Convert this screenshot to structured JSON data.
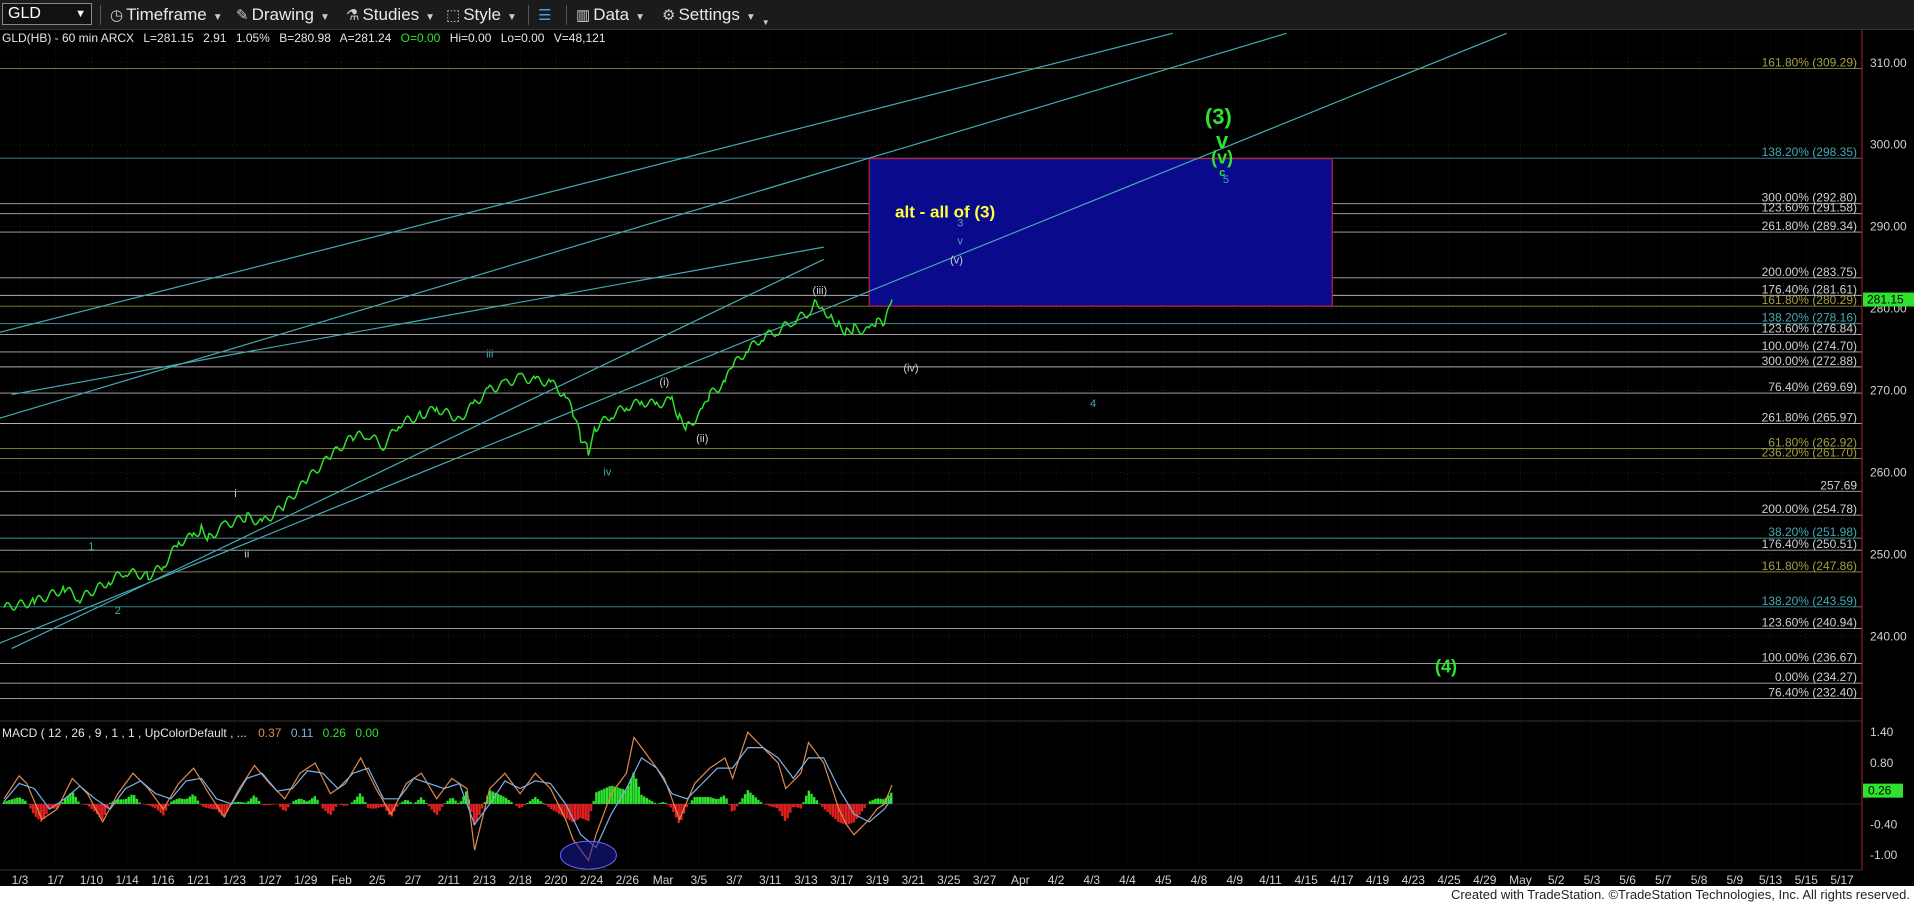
{
  "toolbar": {
    "symbol": "GLD",
    "timeframe_label": "Timeframe",
    "drawing_label": "Drawing",
    "studies_label": "Studies",
    "style_label": "Style",
    "data_label": "Data",
    "settings_label": "Settings",
    "icons": [
      "timeframe-clock-icon",
      "pencil-icon",
      "flask-icon",
      "style-icon",
      "layout-icon",
      "bar-chart-icon",
      "gear-icon"
    ]
  },
  "chart_info": {
    "header": "GLD(HB) - 60 min  ARCX",
    "last": "L=281.15",
    "change": "2.91",
    "change_pct": "1.05%",
    "bid": "B=280.98",
    "ask": "A=281.24",
    "open": "O=0.00",
    "high": "Hi=0.00",
    "low": "Lo=0.00",
    "volume": "V=48,121"
  },
  "chart_data": [
    {
      "type": "line",
      "name": "price",
      "ylim": [
        231,
        314
      ],
      "x_ticks": [
        "1/3",
        "1/7",
        "1/10",
        "1/14",
        "1/16",
        "1/21",
        "1/23",
        "1/27",
        "1/29",
        "Feb",
        "2/5",
        "2/7",
        "2/11",
        "2/13",
        "2/18",
        "2/20",
        "2/24",
        "2/26",
        "Mar",
        "3/5",
        "3/7",
        "3/11",
        "3/13",
        "3/17",
        "3/19",
        "3/21",
        "3/25",
        "3/27",
        "Apr",
        "4/2",
        "4/3",
        "4/4",
        "4/5",
        "4/8",
        "4/9",
        "4/11",
        "4/15",
        "4/17",
        "4/19",
        "4/23",
        "4/25",
        "4/29",
        "May",
        "5/2",
        "5/3",
        "5/6",
        "5/7",
        "5/8",
        "5/9",
        "5/13",
        "5/15",
        "5/17"
      ],
      "y_ticks": [
        240,
        250,
        260,
        270,
        280,
        290,
        300,
        310
      ],
      "last_price_label": "281.15",
      "price_series": [
        [
          0,
          243.5
        ],
        [
          4,
          244.2
        ],
        [
          8,
          245.8
        ],
        [
          10,
          244.6
        ],
        [
          14,
          246.8
        ],
        [
          16,
          247.9
        ],
        [
          19,
          247.3
        ],
        [
          21,
          248.6
        ],
        [
          23,
          251.4
        ],
        [
          25,
          252.3
        ],
        [
          26,
          253.1
        ],
        [
          27,
          252.0
        ],
        [
          29,
          253.5
        ],
        [
          32,
          254.6
        ],
        [
          34,
          253.8
        ],
        [
          37,
          256.0
        ],
        [
          40,
          259.2
        ],
        [
          43,
          262.0
        ],
        [
          46,
          264.4
        ],
        [
          48,
          264.6
        ],
        [
          50,
          263.2
        ],
        [
          52,
          265.9
        ],
        [
          55,
          267.0
        ],
        [
          57,
          267.8
        ],
        [
          60,
          266.5
        ],
        [
          62,
          268.4
        ],
        [
          64,
          270.1
        ],
        [
          66,
          270.8
        ],
        [
          68,
          271.6
        ],
        [
          70,
          271.2
        ],
        [
          72,
          271.0
        ],
        [
          74,
          269.3
        ],
        [
          75,
          267.2
        ],
        [
          76,
          264.2
        ],
        [
          77,
          262.6
        ],
        [
          78,
          265.5
        ],
        [
          80,
          267.0
        ],
        [
          82,
          268.0
        ],
        [
          84,
          268.6
        ],
        [
          86,
          268.3
        ],
        [
          88,
          268.8
        ],
        [
          89,
          266.6
        ],
        [
          90,
          265.5
        ],
        [
          92,
          267.4
        ],
        [
          93,
          269.5
        ],
        [
          95,
          271.0
        ],
        [
          96,
          273.0
        ],
        [
          98,
          275.0
        ],
        [
          100,
          276.5
        ],
        [
          102,
          277.3
        ],
        [
          104,
          278.5
        ],
        [
          106,
          279.5
        ],
        [
          107,
          281.1
        ],
        [
          108,
          279.8
        ],
        [
          109,
          279.0
        ],
        [
          110,
          278.0
        ],
        [
          111,
          277.1
        ],
        [
          112,
          277.6
        ],
        [
          114,
          277.2
        ],
        [
          115,
          278.4
        ],
        [
          116,
          278.0
        ],
        [
          117,
          281.1
        ]
      ],
      "fib_levels": [
        {
          "label": "161.80% (309.29)",
          "value": 309.29,
          "color": "#a29f44"
        },
        {
          "label": "138.20% (298.35)",
          "value": 298.35,
          "color": "#46a8b3"
        },
        {
          "label": "300.00% (292.80)",
          "value": 292.8,
          "color": "#cfcfcf"
        },
        {
          "label": "123.60% (291.58)",
          "value": 291.58,
          "color": "#cfcfcf"
        },
        {
          "label": "261.80% (289.34)",
          "value": 289.34,
          "color": "#cfcfcf"
        },
        {
          "label": "200.00% (283.75)",
          "value": 283.75,
          "color": "#cfcfcf"
        },
        {
          "label": "176.40% (281.61)",
          "value": 281.61,
          "color": "#cfcfcf"
        },
        {
          "label": "161.80% (280.29)",
          "value": 280.29,
          "color": "#a29f44"
        },
        {
          "label": "138.20% (278.16)",
          "value": 278.16,
          "color": "#46a8b3"
        },
        {
          "label": "123.60% (276.84)",
          "value": 276.84,
          "color": "#cfcfcf"
        },
        {
          "label": "100.00% (274.70)",
          "value": 274.7,
          "color": "#cfcfcf"
        },
        {
          "label": "300.00% (272.88)",
          "value": 272.88,
          "color": "#cfcfcf"
        },
        {
          "label": "76.40% (269.69)",
          "value": 269.69,
          "color": "#cfcfcf"
        },
        {
          "label": "261.80% (265.97)",
          "value": 265.97,
          "color": "#cfcfcf"
        },
        {
          "label": "61.80% (262.92)",
          "value": 262.92,
          "color": "#a29f44"
        },
        {
          "label": "236.20% (261.70)",
          "value": 261.7,
          "color": "#a29f44"
        },
        {
          "label": "257.69",
          "value": 257.69,
          "color": "#cfcfcf"
        },
        {
          "label": "200.00% (254.78)",
          "value": 254.78,
          "color": "#cfcfcf"
        },
        {
          "label": "38.20% (251.98)",
          "value": 251.98,
          "color": "#46a8b3"
        },
        {
          "label": "176.40% (250.51)",
          "value": 250.51,
          "color": "#cfcfcf"
        },
        {
          "label": "161.80% (247.86)",
          "value": 247.86,
          "color": "#a29f44"
        },
        {
          "label": "138.20% (243.59)",
          "value": 243.59,
          "color": "#46a8b3"
        },
        {
          "label": "123.60% (240.94)",
          "value": 240.94,
          "color": "#cfcfcf"
        },
        {
          "label": "100.00% (236.67)",
          "value": 236.67,
          "color": "#cfcfcf"
        },
        {
          "label": "0.00% (234.27)",
          "value": 234.27,
          "color": "#cfcfcf"
        },
        {
          "label": "76.40% (232.40)",
          "value": 232.4,
          "color": "#cfcfcf"
        }
      ],
      "target_box": {
        "from_x": 114,
        "to_x": 175,
        "low": 280.3,
        "high": 298.3,
        "fill": "#0a0a8c",
        "edge": "#c0203a"
      },
      "wave_labels": [
        {
          "text": "(3)",
          "x": 160,
          "y": 302.5,
          "color": "#2ee22e"
        },
        {
          "text": "v",
          "x": 160.5,
          "y": 299.6,
          "color": "#2ee22e"
        },
        {
          "text": "(v)",
          "x": 160.5,
          "y": 297.7,
          "color": "#2ee22e"
        },
        {
          "text": "c",
          "x": 160.5,
          "y": 296.2,
          "color": "#2ee22e"
        },
        {
          "text": "5",
          "x": 161,
          "y": 295.3,
          "color": "#46a8b3"
        },
        {
          "text": "alt  - all of (3)",
          "x": 124,
          "y": 291.1,
          "color": "#ffff3a"
        },
        {
          "text": "3",
          "x": 126,
          "y": 290.0,
          "color": "#46a8b3"
        },
        {
          "text": "v",
          "x": 126,
          "y": 287.8,
          "color": "#46a8b3"
        },
        {
          "text": "(v)",
          "x": 125.5,
          "y": 285.5,
          "color": "#cfcfcf"
        },
        {
          "text": "(iii)",
          "x": 107.5,
          "y": 281.8,
          "color": "#cfcfcf"
        },
        {
          "text": "(iv)",
          "x": 119.5,
          "y": 272.3,
          "color": "#cfcfcf"
        },
        {
          "text": "(i)",
          "x": 87,
          "y": 270.6,
          "color": "#cfcfcf"
        },
        {
          "text": "(ii)",
          "x": 92,
          "y": 263.7,
          "color": "#cfcfcf"
        },
        {
          "text": "iii",
          "x": 64,
          "y": 274.0,
          "color": "#46a8b3"
        },
        {
          "text": "iv",
          "x": 79.5,
          "y": 259.6,
          "color": "#46a8b3"
        },
        {
          "text": "4",
          "x": 143.5,
          "y": 268.0,
          "color": "#46a8b3"
        },
        {
          "text": "i",
          "x": 30.5,
          "y": 257.0,
          "color": "#cfcfcf"
        },
        {
          "text": "ii",
          "x": 32,
          "y": 249.6,
          "color": "#cfcfcf"
        },
        {
          "text": "1",
          "x": 11.5,
          "y": 250.5,
          "color": "#46a8b3"
        },
        {
          "text": "2",
          "x": 15,
          "y": 242.7,
          "color": "#46a8b3"
        },
        {
          "text": "(4)",
          "x": 190,
          "y": 235.6,
          "color": "#2ee22e"
        }
      ],
      "channel_lines": [
        {
          "x1": -1,
          "y1": 277.0,
          "x2": 154,
          "y2": 313.6
        },
        {
          "x1": -1,
          "y1": 266.5,
          "x2": 169,
          "y2": 313.6
        },
        {
          "x1": -1,
          "y1": 239.0,
          "x2": 198,
          "y2": 313.6
        },
        {
          "x1": 1,
          "y1": 269.5,
          "x2": 108,
          "y2": 287.5
        },
        {
          "x1": 1,
          "y1": 238.5,
          "x2": 108,
          "y2": 286.0
        }
      ],
      "x_range": [
        0,
        230
      ]
    },
    {
      "type": "line",
      "name": "MACD",
      "legend": "MACD ( 12 , 26 , 9 , 1 , 1 , UpColorDefault , ...",
      "legend_values": [
        "0.37",
        "0.11",
        "0.26",
        "0.00"
      ],
      "legend_colors": [
        "#e08a4e",
        "#7fb0e6",
        "#2ee22e",
        "#2ee22e"
      ],
      "y_ticks": [
        "1.40",
        "0.80",
        "-0.40",
        "-1.00"
      ],
      "ylim": [
        -1.25,
        1.6
      ],
      "current_label": "0.26",
      "macd_series": [
        [
          0,
          0.1
        ],
        [
          2,
          0.55
        ],
        [
          3,
          0.4
        ],
        [
          5,
          -0.3
        ],
        [
          7,
          -0.1
        ],
        [
          9,
          0.5
        ],
        [
          11,
          0.2
        ],
        [
          13,
          -0.35
        ],
        [
          15,
          0.2
        ],
        [
          17,
          0.6
        ],
        [
          19,
          0.3
        ],
        [
          21,
          -0.1
        ],
        [
          23,
          0.4
        ],
        [
          25,
          0.7
        ],
        [
          27,
          0.2
        ],
        [
          29,
          -0.25
        ],
        [
          31,
          0.3
        ],
        [
          33,
          0.75
        ],
        [
          35,
          0.4
        ],
        [
          37,
          0.1
        ],
        [
          39,
          0.6
        ],
        [
          41,
          0.8
        ],
        [
          43,
          0.2
        ],
        [
          45,
          0.4
        ],
        [
          47,
          0.9
        ],
        [
          49,
          0.3
        ],
        [
          51,
          -0.2
        ],
        [
          53,
          0.4
        ],
        [
          55,
          0.6
        ],
        [
          57,
          0.1
        ],
        [
          59,
          0.5
        ],
        [
          61,
          0.3
        ],
        [
          62,
          -0.9
        ],
        [
          64,
          0.3
        ],
        [
          66,
          0.6
        ],
        [
          68,
          0.2
        ],
        [
          70,
          0.6
        ],
        [
          72,
          0.3
        ],
        [
          74,
          -0.3
        ],
        [
          75,
          -0.7
        ],
        [
          76,
          -0.9
        ],
        [
          77,
          -1.1
        ],
        [
          78,
          -0.6
        ],
        [
          80,
          0.2
        ],
        [
          82,
          0.6
        ],
        [
          83,
          1.3
        ],
        [
          85,
          0.9
        ],
        [
          87,
          0.5
        ],
        [
          89,
          -0.3
        ],
        [
          91,
          0.4
        ],
        [
          93,
          0.7
        ],
        [
          95,
          0.9
        ],
        [
          96,
          0.5
        ],
        [
          98,
          1.4
        ],
        [
          100,
          1.1
        ],
        [
          102,
          0.8
        ],
        [
          103,
          0.3
        ],
        [
          105,
          0.6
        ],
        [
          106,
          1.2
        ],
        [
          108,
          0.8
        ],
        [
          110,
          -0.1
        ],
        [
          111,
          -0.4
        ],
        [
          112,
          -0.6
        ],
        [
          114,
          -0.3
        ],
        [
          115,
          -0.1
        ],
        [
          116,
          0.0
        ],
        [
          117,
          0.37
        ]
      ],
      "signal_series": [
        [
          0,
          0.05
        ],
        [
          2,
          0.4
        ],
        [
          4,
          0.3
        ],
        [
          6,
          -0.1
        ],
        [
          8,
          0.1
        ],
        [
          10,
          0.35
        ],
        [
          12,
          0.1
        ],
        [
          14,
          -0.1
        ],
        [
          16,
          0.3
        ],
        [
          18,
          0.45
        ],
        [
          20,
          0.2
        ],
        [
          22,
          0.1
        ],
        [
          24,
          0.45
        ],
        [
          26,
          0.5
        ],
        [
          28,
          0.1
        ],
        [
          30,
          0.0
        ],
        [
          32,
          0.5
        ],
        [
          34,
          0.6
        ],
        [
          36,
          0.25
        ],
        [
          38,
          0.3
        ],
        [
          40,
          0.65
        ],
        [
          42,
          0.6
        ],
        [
          44,
          0.3
        ],
        [
          46,
          0.6
        ],
        [
          48,
          0.7
        ],
        [
          50,
          0.1
        ],
        [
          52,
          0.1
        ],
        [
          54,
          0.5
        ],
        [
          56,
          0.4
        ],
        [
          58,
          0.3
        ],
        [
          60,
          0.4
        ],
        [
          62,
          -0.4
        ],
        [
          64,
          0.0
        ],
        [
          66,
          0.45
        ],
        [
          68,
          0.3
        ],
        [
          70,
          0.45
        ],
        [
          72,
          0.4
        ],
        [
          74,
          0.0
        ],
        [
          76,
          -0.6
        ],
        [
          78,
          -0.85
        ],
        [
          80,
          -0.2
        ],
        [
          82,
          0.3
        ],
        [
          84,
          0.9
        ],
        [
          86,
          0.7
        ],
        [
          88,
          0.2
        ],
        [
          90,
          0.1
        ],
        [
          92,
          0.4
        ],
        [
          94,
          0.7
        ],
        [
          96,
          0.7
        ],
        [
          98,
          1.1
        ],
        [
          100,
          1.1
        ],
        [
          102,
          0.9
        ],
        [
          104,
          0.5
        ],
        [
          106,
          0.9
        ],
        [
          108,
          0.9
        ],
        [
          110,
          0.3
        ],
        [
          112,
          -0.2
        ],
        [
          114,
          -0.35
        ],
        [
          116,
          -0.1
        ],
        [
          117,
          0.11
        ]
      ]
    }
  ],
  "footer": "Created with TradeStation. ©TradeStation Technologies, Inc. All rights reserved."
}
